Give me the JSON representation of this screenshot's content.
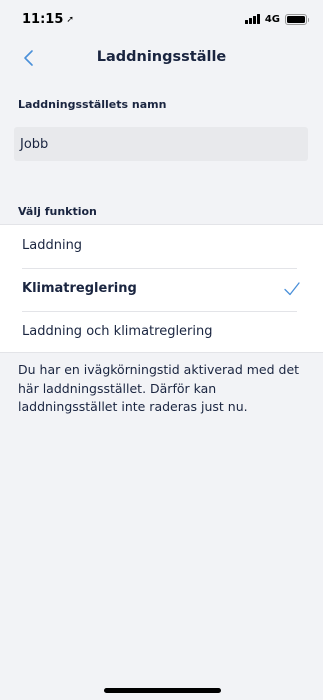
{
  "status_bar": {
    "time": "11:15",
    "network": "4G",
    "signal_bars": 4,
    "battery_level": 1.0
  },
  "nav": {
    "title": "Laddningsställe",
    "back_icon": "chevron-left-icon"
  },
  "name_section": {
    "label": "Laddningsställets namn",
    "value": "Jobb"
  },
  "function_section": {
    "label": "Välj funktion",
    "options": [
      {
        "label": "Laddning",
        "selected": false
      },
      {
        "label": "Klimatreglering",
        "selected": true
      },
      {
        "label": "Laddning och klimatreglering",
        "selected": false
      }
    ]
  },
  "info": {
    "text": "Du har en ivägkörningstid aktiverad med det här laddningsstället. Därför kan laddningsstället inte raderas just nu."
  },
  "colors": {
    "accent": "#4a90d9",
    "text": "#1a2540",
    "background": "#f2f3f6"
  }
}
